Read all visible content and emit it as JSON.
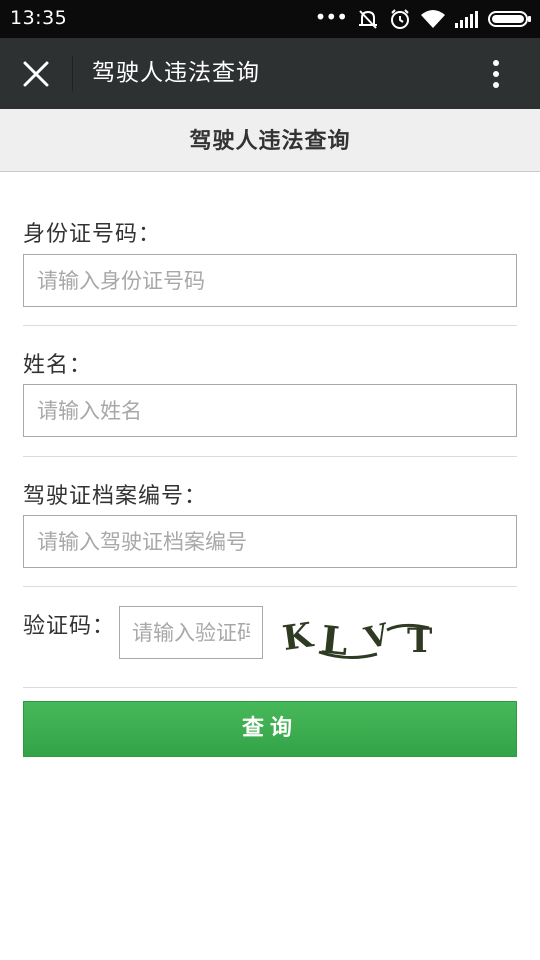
{
  "status_bar": {
    "time": "13:35",
    "icons": [
      "dots-icon",
      "mute-vibrate-icon",
      "alarm-icon",
      "wifi-icon",
      "signal-icon",
      "battery-icon"
    ]
  },
  "app_bar": {
    "title": "驾驶人违法查询",
    "close_icon": "close-icon",
    "more_icon": "more-vertical-icon"
  },
  "page": {
    "header_title": "驾驶人违法查询"
  },
  "form": {
    "id_number": {
      "label": "身份证号码：",
      "placeholder": "请输入身份证号码",
      "value": ""
    },
    "name": {
      "label": "姓名：",
      "placeholder": "请输入姓名",
      "value": ""
    },
    "license_file": {
      "label": "驾驶证档案编号：",
      "placeholder": "请输入驾驶证档案编号",
      "value": ""
    },
    "captcha": {
      "label": "验证码：",
      "placeholder": "请输入验证码",
      "value": "",
      "image_text": "KLVT"
    },
    "submit_label": "查询"
  },
  "colors": {
    "status_bar_bg": "#0b0b0b",
    "app_bar_bg": "#2e3132",
    "header_bg": "#efefef",
    "button_green": "#3aab4e",
    "captcha_text": "#2f3a22"
  }
}
